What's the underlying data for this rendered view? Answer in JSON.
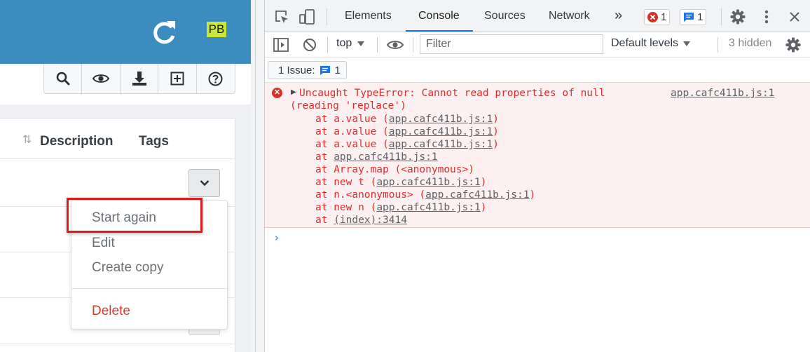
{
  "app": {
    "avatar_initials": "PB",
    "header_color": "#3b8dc0",
    "toolbar_icons": [
      "search-icon",
      "eye-icon",
      "download-icon",
      "plus-square-icon",
      "help-icon"
    ],
    "columns": {
      "description": "Description",
      "tags": "Tags"
    },
    "row_menu": {
      "start_again": "Start again",
      "edit": "Edit",
      "create_copy": "Create copy",
      "delete": "Delete"
    }
  },
  "devtools": {
    "tabs": {
      "elements": "Elements",
      "console": "Console",
      "sources": "Sources",
      "network": "Network"
    },
    "more_tabs": "»",
    "error_count": "1",
    "message_count": "1",
    "context": "top",
    "filter_placeholder": "Filter",
    "levels": "Default levels",
    "hidden": "3 hidden",
    "issues_label": "1 Issue:",
    "issues_count": "1",
    "error": {
      "line1": "Uncaught TypeError: Cannot read properties of null",
      "line2": "(reading 'replace')",
      "source": "app.cafc411b.js:1",
      "stack": [
        {
          "prefix": "at a.value (",
          "link": "app.cafc411b.js:1",
          "suffix": ")"
        },
        {
          "prefix": "at a.value (",
          "link": "app.cafc411b.js:1",
          "suffix": ")"
        },
        {
          "prefix": "at a.value (",
          "link": "app.cafc411b.js:1",
          "suffix": ")"
        },
        {
          "prefix": "at ",
          "link": "app.cafc411b.js:1",
          "suffix": ""
        },
        {
          "prefix": "at Array.map (<anonymous>)",
          "link": "",
          "suffix": ""
        },
        {
          "prefix": "at new t (",
          "link": "app.cafc411b.js:1",
          "suffix": ")"
        },
        {
          "prefix": "at n.<anonymous> (",
          "link": "app.cafc411b.js:1",
          "suffix": ")"
        },
        {
          "prefix": "at new n (",
          "link": "app.cafc411b.js:1",
          "suffix": ")"
        },
        {
          "prefix": "at ",
          "link": "(index):3414",
          "suffix": ""
        }
      ]
    },
    "prompt": "›",
    "accent_color": "#1a73e8",
    "error_color": "#e22c2c"
  }
}
